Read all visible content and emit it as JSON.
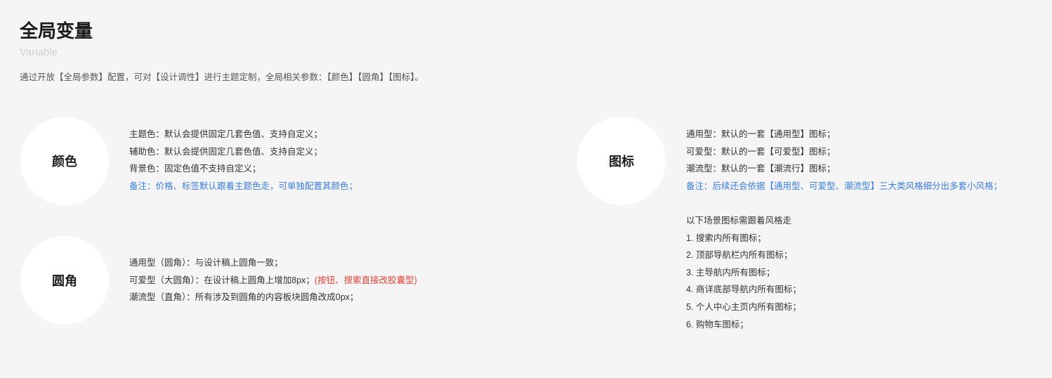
{
  "header": {
    "title": "全局变量",
    "subtitle": "Variable",
    "intro": "通过开放【全局参数】配置，可对【设计调性】进行主题定制，全局相关参数：【颜色】【圆角】【图标】。"
  },
  "colors": {
    "background": "#f5f5f5",
    "circle": "#ffffff",
    "note": "#3b7ddd",
    "warning": "#e8413a"
  },
  "color_section": {
    "label": "颜色",
    "lines": [
      "主题色：默认会提供固定几套色值、支持自定义；",
      "辅助色：默认会提供固定几套色值、支持自定义；",
      "背景色：固定色值不支持自定义；"
    ],
    "note": "备注：价格、标签默认跟着主题色走，可单独配置其颜色；"
  },
  "radius_section": {
    "label": "圆角",
    "lines": [
      "通用型（圆角）：与设计稿上圆角一致；",
      "可爱型（大圆角）：在设计稿上圆角上增加8px；",
      "潮流型（直角）：所有涉及到圆角的内容板块圆角改成0px；"
    ],
    "line2_highlight": "(按钮、搜索直接改胶囊型)"
  },
  "icon_section": {
    "label": "图标",
    "lines": [
      "通用型：默认的一套【通用型】图标；",
      "可爱型：默认的一套【可爱型】图标；",
      "潮流型：默认的一套【潮流行】图标；"
    ],
    "note": "备注：后续还会依据【通用型、可爱型、潮流型】三大类风格细分出多套小风格；",
    "scene_title": "以下场景图标需跟着风格走",
    "scene_items": [
      "1. 搜索内所有图标；",
      "2. 顶部导航栏内所有图标；",
      "3. 主导航内所有图标；",
      "4. 商详底部导航内所有图标；",
      "5. 个人中心主页内所有图标；",
      "6. 购物车图标；"
    ]
  }
}
